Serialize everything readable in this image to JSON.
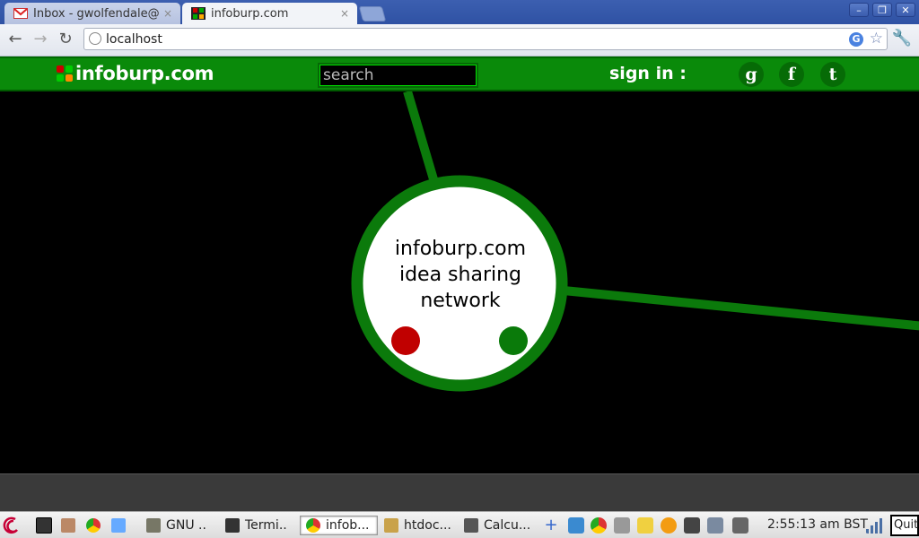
{
  "browser": {
    "tabs": [
      {
        "title": "Inbox - gwolfendale@gr",
        "active": false,
        "close": "×"
      },
      {
        "title": "infoburp.com",
        "active": true,
        "close": "×"
      }
    ],
    "window_controls": {
      "minimize": "–",
      "restore": "❐",
      "close": "✕"
    },
    "nav": {
      "back": "←",
      "forward": "→",
      "reload": "↻"
    },
    "address": "localhost",
    "search_engine_badge": "G",
    "bookmark_star": "☆",
    "settings_icon": "🔧"
  },
  "site": {
    "logo_text": "infoburp.com",
    "search_placeholder": "search",
    "signin_label": "sign in :",
    "social": [
      {
        "name": "google",
        "glyph": "g"
      },
      {
        "name": "facebook",
        "glyph": "f"
      },
      {
        "name": "tumblr",
        "glyph": "t"
      }
    ],
    "colors": {
      "brand_green": "#0a8a0a",
      "node_ring": "#0b7a0b",
      "red_dot": "#c00000",
      "green_dot": "#0a7a0a"
    }
  },
  "graph": {
    "node": {
      "lines": [
        "infoburp.com",
        "idea sharing",
        "network"
      ]
    }
  },
  "taskbar": {
    "items": [
      {
        "label": "GNU ..",
        "active": false
      },
      {
        "label": "Termi..",
        "active": false
      },
      {
        "label": "infob...",
        "active": true
      },
      {
        "label": "htdoc...",
        "active": false
      },
      {
        "label": "Calcu...",
        "active": false
      }
    ],
    "clock": "2:55:13 am BST",
    "quit_label": "Quit"
  }
}
